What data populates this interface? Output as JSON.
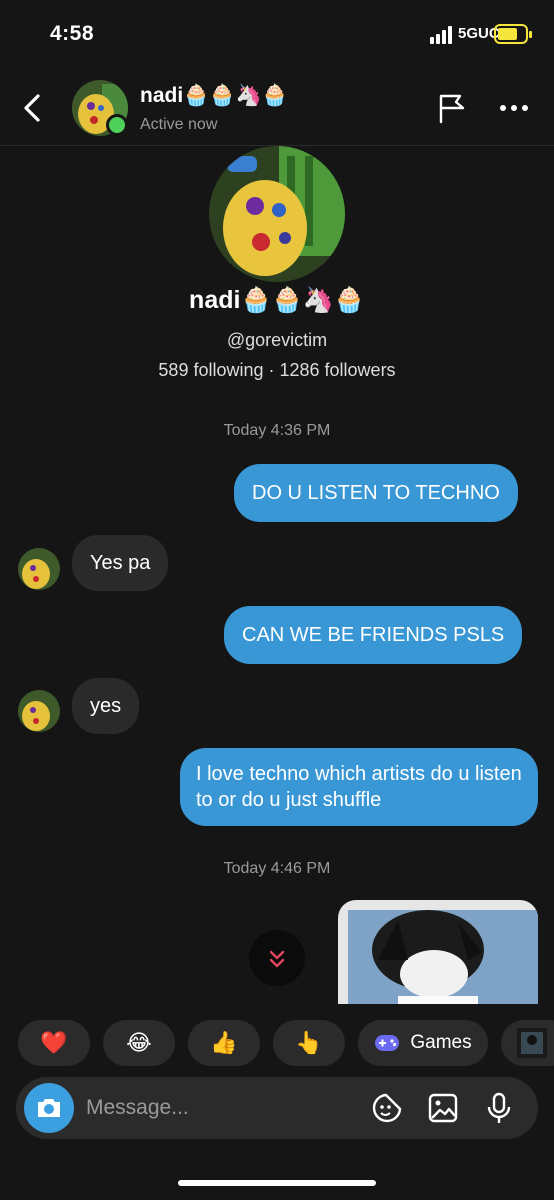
{
  "status_bar": {
    "time": "4:58",
    "network": "5GUC",
    "icons": [
      "signal-icon",
      "battery-charging-icon"
    ]
  },
  "header": {
    "name": "nadi🧁🧁🦄🧁",
    "status": "Active now",
    "icons": [
      "back-icon",
      "flag-icon",
      "more-icon"
    ]
  },
  "profile": {
    "name": "nadi🧁🧁🦄🧁",
    "handle": "@gorevictim",
    "stats": "589 following · 1286 followers"
  },
  "messages": [
    {
      "type": "timestamp",
      "text": "Today 4:36 PM"
    },
    {
      "type": "outgoing",
      "text": "DO U LISTEN TO TECHNO"
    },
    {
      "type": "incoming",
      "text": "Yes pa"
    },
    {
      "type": "outgoing",
      "text": "CAN WE BE FRIENDS PSLS"
    },
    {
      "type": "incoming",
      "text": "yes"
    },
    {
      "type": "outgoing",
      "text": "I love techno which artists do u listen to or do u just shuffle"
    },
    {
      "type": "timestamp",
      "text": "Today 4:46 PM"
    },
    {
      "type": "outgoing-image",
      "text": ""
    }
  ],
  "quick_bar": {
    "reactions": [
      "❤️",
      "😂",
      "👍",
      "👆"
    ],
    "games_label": "Games"
  },
  "composer": {
    "placeholder": "Message...",
    "icons": [
      "camera-icon",
      "sticker-icon",
      "gallery-icon",
      "microphone-icon"
    ]
  },
  "colors": {
    "background": "#151515",
    "outgoing_bubble": "#3a97d6",
    "incoming_bubble": "#2a2a2a",
    "online": "#4ed05a",
    "accent": "#3b9fe0"
  }
}
